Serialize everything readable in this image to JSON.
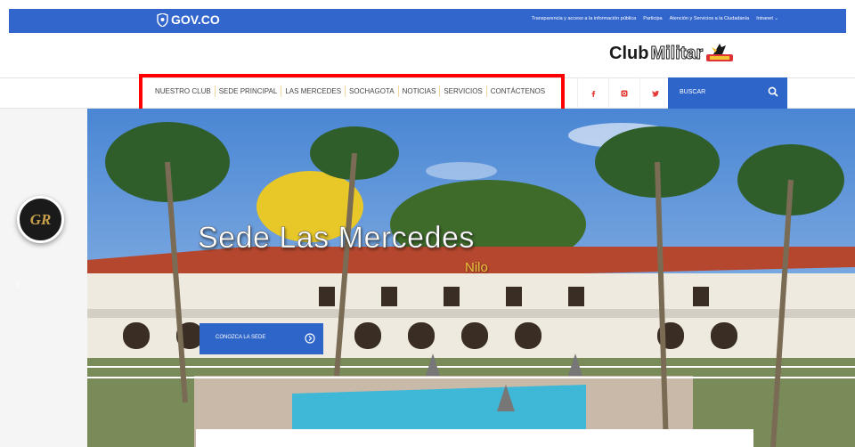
{
  "gov_bar": {
    "logo_text": "GOV.CO",
    "links": [
      "Transparencia y acceso a la información pública",
      "Participa",
      "Atención y Servicios a la Ciudadanía",
      "Intranet ⌄"
    ]
  },
  "brand": {
    "club": "Club",
    "militar": "Militar"
  },
  "menu": {
    "items": [
      "NUESTRO CLUB",
      "SEDE PRINCIPAL",
      "LAS MERCEDES",
      "SOCHAGOTA",
      "NOTICIAS",
      "SERVICIOS",
      "CONTÁCTENOS"
    ]
  },
  "social": {
    "facebook_color": "#e53935",
    "instagram_color": "#e53935",
    "twitter_color": "#e53935"
  },
  "search": {
    "label": "BUSCAR"
  },
  "hero": {
    "title": "Sede Las Mercedes",
    "subtitle": "Nilo",
    "cta_label": "CONOZCA LA SEDE",
    "prev_arrow": "‹"
  },
  "badge": {
    "monogram": "GR"
  },
  "colors": {
    "gov_blue": "#3366cc",
    "accent_blue": "#2e65c9",
    "highlight": "#ff0000"
  }
}
